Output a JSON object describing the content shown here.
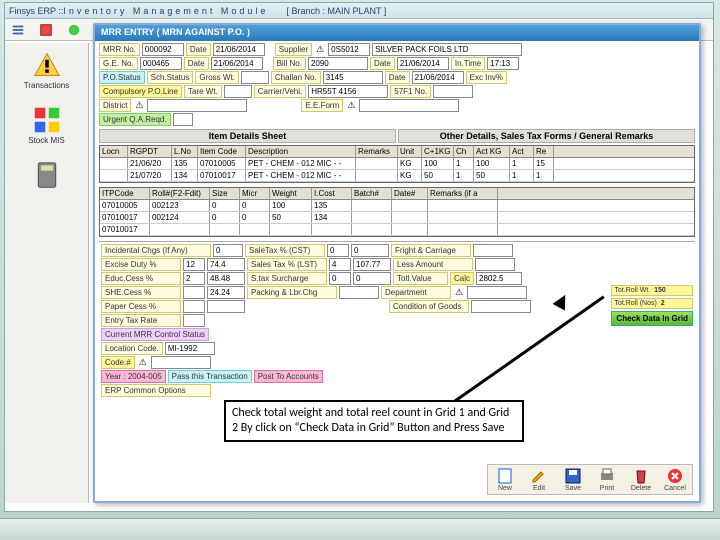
{
  "window": {
    "title_prefix": "Finsys ERP :: ",
    "title_main": "Inventory Management Module",
    "branch_label": "[ Branch : MAIN PLANT ]"
  },
  "sidebar": {
    "items": [
      {
        "label": "Transactions"
      },
      {
        "label": "Stock MIS"
      }
    ]
  },
  "mrr": {
    "title": "MRR ENTRY  ( MRN AGAINST P.O. )",
    "mrr_no_label": "MRR  No.",
    "mrr_no": "000092",
    "date_label": "Date",
    "date1": "21/06/2014",
    "supplier_label": "Supplier",
    "supplier_code": "0S5012",
    "supplier_name": "SILVER PACK FOILS LTD",
    "ge_label": "G.E.  No.",
    "ge_no": "000465",
    "date2": "21/06/2014",
    "bill_label": "Bill No.",
    "bill_no": "2090",
    "bill_date": "21/06/2014",
    "intime_label": "In.Time",
    "intime": "17:13",
    "postatus_label": "P.O.Status",
    "schstatus_label": "Sch.Status",
    "grosswt_label": "Gross Wt.",
    "challan_label": "Challan No.",
    "challan_no": "3145",
    "challan_date": "21/06/2014",
    "excinv_label": "Exc Inv%",
    "comp_po_label": "Compulsory P.O.Line",
    "tarewt_label": "Tare Wt.",
    "carrier_label": "Carrier/Vehi.",
    "carrier": "HR55T 4156",
    "fo_label": "57F1 No.",
    "district_label": "District",
    "eeform_label": "E.E.Form",
    "urg_label": "Urgent Q.A.Reqd.",
    "sheet1_title": "Item Details Sheet",
    "sheet2_title": "Other Details, Sales Tax Forms / General Remarks"
  },
  "grid1": {
    "headers": [
      "Locn",
      "RGPDT",
      "L.No",
      "Item Code",
      "Description",
      "Remarks",
      "Unit",
      "C+1KG",
      "Ch",
      "Act KG",
      "Act",
      "Re"
    ],
    "rows": [
      [
        "",
        "21/06/20",
        "135",
        "07010005",
        "PET - CHEM - 012 MIC - -",
        "",
        "KG",
        "100",
        "1",
        "100",
        "1",
        "15"
      ],
      [
        "",
        "21/07/20",
        "134",
        "07010017",
        "PET - CHEM - 012 MIC - -",
        "",
        "KG",
        "50",
        "1",
        "50",
        "1",
        "1"
      ]
    ]
  },
  "grid2": {
    "headers": [
      "ITPCode",
      "Roll#(F2-Fdit)",
      "Size",
      "Micr",
      "Weight",
      "I.Cost",
      "Batch#",
      "Date#",
      "Remarks (if a"
    ],
    "rows": [
      [
        "07010005",
        "002123",
        "0",
        "0",
        "100",
        "135",
        "",
        "",
        ""
      ],
      [
        "07010017",
        "002124",
        "0",
        "0",
        "50",
        "134",
        "",
        "",
        ""
      ],
      [
        "07010017",
        "",
        "",
        "",
        "",
        "",
        "",
        "",
        ""
      ]
    ]
  },
  "side_buttons": {
    "totroll_label": "Tot.Roll Wt.",
    "totroll_val": "150",
    "rollnos_label": "Tot.Roll (Nos)",
    "rollnos_val": "2",
    "check_btn": "Check Data In Grid"
  },
  "charges": {
    "header": "Incidental Chgs (If Any)",
    "excise": "Excise Duty %",
    "excise_v": "12",
    "excise_amt": "74.4",
    "educ": "Educ.Cess %",
    "educ_v": "2",
    "educ_amt": "48.48",
    "she": "SHE.Cess %",
    "she_amt": "24.24",
    "paper": "Paper Cess %",
    "entry": "Entry Tax Rate",
    "sale_l": "SaleTax % (CST)",
    "sale_v": "0",
    "sale_a": "0",
    "lst_l": "Sales Tax % (LST)",
    "lst_v": "4",
    "lst_a": "107.77",
    "sur_l": "S.tax Surcharge",
    "sur_v": "0",
    "sur_a": "0",
    "pack_l": "Packing & Lbr.Chg",
    "fright": "Fright & Carriage",
    "less": "Less Amount",
    "tot": "Totl.Value",
    "tot_btn": "Calc",
    "tot_v": "2802.5",
    "dept": "Department",
    "cond": "Condition of Goods",
    "ctrl": "Current MRR Control Status",
    "loc": "Location Code.",
    "loc_v": "MI-1992",
    "code": "Code.#",
    "year": "Year : 2004-005",
    "pass": "Pass this Transaction",
    "post": "Post To Accounts",
    "erpopt": "ERP Common Options"
  },
  "btns": {
    "new": "New",
    "edit": "Edit",
    "save": "Save",
    "print": "Print",
    "delete": "Delete",
    "cancel": "Cancel"
  },
  "callout": "Check total weight and total reel count in Grid 1 and Grid 2 By click on “Check Data in Grid” Button and Press Save",
  "brand": "Finsys ERP"
}
